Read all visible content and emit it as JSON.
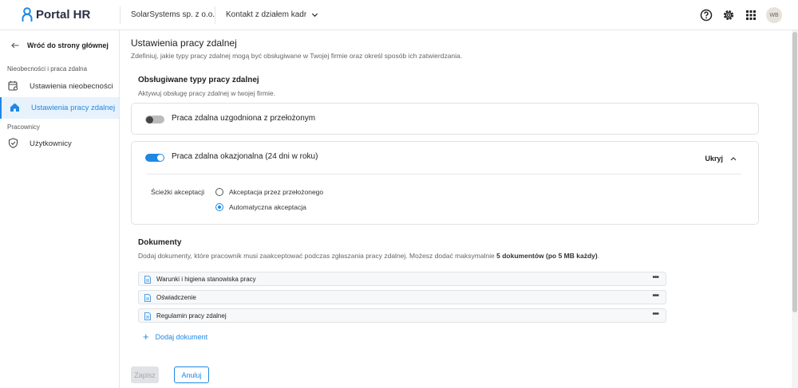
{
  "app": {
    "name": "Portal HR"
  },
  "header": {
    "company": "SolarSystems sp. z o.o.",
    "contact": "Kontakt z działem kadr",
    "avatar_initials": "WB"
  },
  "sidebar": {
    "back_label": "Wróć do strony głównej",
    "sections": [
      {
        "title": "Nieobecności i praca zdalna"
      },
      {
        "title": "Pracownicy"
      }
    ],
    "items": [
      {
        "label": "Ustawienia nieobecności",
        "icon": "calendar-settings-icon",
        "active": false
      },
      {
        "label": "Ustawienia pracy zdalnej",
        "icon": "home-icon",
        "active": true
      },
      {
        "label": "Użytkownicy",
        "icon": "shield-check-icon",
        "active": false
      }
    ]
  },
  "page": {
    "title": "Ustawienia pracy zdalnej",
    "subtitle": "Zdefiniuj, jakie typy pracy zdalnej mogą być obsługiwane w Twojej firmie oraz określ sposób ich zatwierdzania."
  },
  "types_section": {
    "title": "Obsługiwane typy pracy zdalnej",
    "subtitle": "Aktywuj obsługę pracy zdalnej w twojej firmie.",
    "types": [
      {
        "label": "Praca zdalna uzgodniona z przełożonym",
        "enabled": false
      },
      {
        "label": "Praca zdalna okazjonalna (24 dni w roku)",
        "enabled": true,
        "toggle_label": "Ukryj"
      }
    ],
    "paths_label": "Ścieżki akceptacji",
    "paths": [
      {
        "label": "Akceptacja przez przełożonego",
        "selected": false
      },
      {
        "label": "Automatyczna akceptacja",
        "selected": true
      }
    ]
  },
  "documents": {
    "title": "Dokumenty",
    "subtitle_pre": "Dodaj dokumenty, które pracownik musi zaakceptować podczas zgłaszania pracy zdalnej. Możesz dodać maksymalnie ",
    "subtitle_bold": "5 dokumentów (po 5 MB każdy)",
    "subtitle_post": ".",
    "items": [
      {
        "name": "Warunki i higiena stanowiska pracy"
      },
      {
        "name": "Oświadczenie"
      },
      {
        "name": "Regulamin pracy zdalnej"
      }
    ],
    "more_label": "•••",
    "add_label": "Dodaj dokument"
  },
  "actions": {
    "save_label": "Zapisz",
    "cancel_label": "Anuluj"
  },
  "colors": {
    "accent": "#1e88e5",
    "active_bg": "#e8f2fc"
  }
}
